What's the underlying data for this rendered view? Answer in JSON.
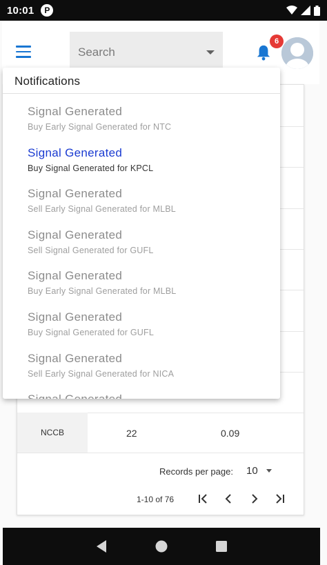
{
  "status_bar": {
    "time": "10:01",
    "carrier_icon_letter": "P"
  },
  "header": {
    "search_placeholder": "Search",
    "notification_count": "6"
  },
  "notifications": {
    "title": "Notifications",
    "items": [
      {
        "title": "Signal Generated",
        "subtitle": "Buy Early Signal Generated for NTC",
        "unread": false
      },
      {
        "title": "Signal Generated",
        "subtitle": "Buy Signal Generated for KPCL",
        "unread": true
      },
      {
        "title": "Signal Generated",
        "subtitle": "Sell Early Signal Generated for MLBL",
        "unread": false
      },
      {
        "title": "Signal Generated",
        "subtitle": "Sell Signal Generated for GUFL",
        "unread": false
      },
      {
        "title": "Signal Generated",
        "subtitle": "Buy Early Signal Generated for MLBL",
        "unread": false
      },
      {
        "title": "Signal Generated",
        "subtitle": "Buy Signal Generated for GUFL",
        "unread": false
      },
      {
        "title": "Signal Generated",
        "subtitle": "Sell Early Signal Generated for NICA",
        "unread": false
      },
      {
        "title": "Signal Generated",
        "subtitle": "",
        "unread": false
      }
    ]
  },
  "table": {
    "visible_row": {
      "symbol": "NCCB",
      "col2": "22",
      "col3": "0.09"
    },
    "pagination": {
      "records_per_page_label": "Records per page:",
      "records_per_page_value": "10",
      "range_text": "1-10 of 76"
    }
  },
  "colors": {
    "accent": "#1976d2",
    "unread_title": "#1a3bd1",
    "badge": "#e53935"
  }
}
